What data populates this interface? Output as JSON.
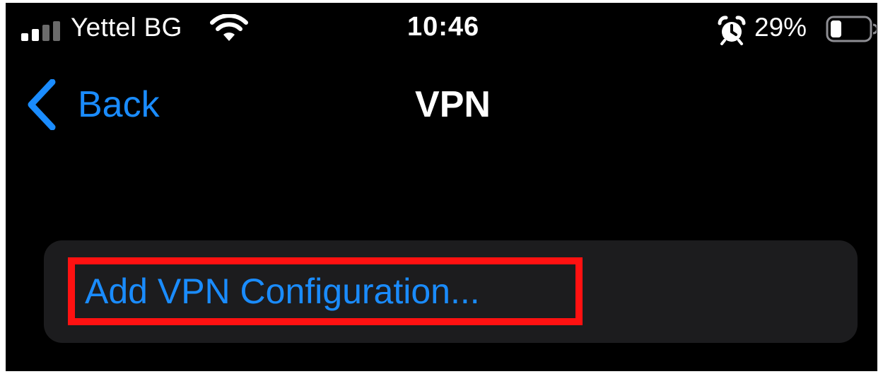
{
  "status_bar": {
    "carrier": "Yettel BG",
    "time": "10:46",
    "battery_percent": "29%",
    "signal_icon": "signal-bars-icon",
    "wifi_icon": "wifi-icon",
    "alarm_icon": "alarm-clock-icon",
    "battery_icon": "battery-icon",
    "battery_level": 0.29
  },
  "nav": {
    "back_label": "Back",
    "back_icon": "chevron-left-icon",
    "title": "VPN"
  },
  "list": {
    "add_vpn_label": "Add VPN Configuration..."
  },
  "colors": {
    "background": "#000000",
    "accent": "#1a8cff",
    "group_background": "#1c1c1e",
    "highlight_border": "#ff1111",
    "text": "#ffffff"
  }
}
